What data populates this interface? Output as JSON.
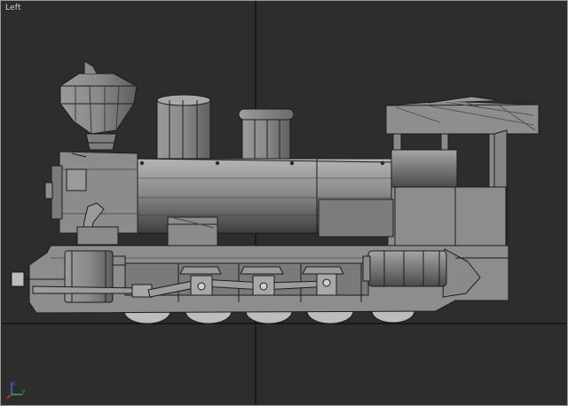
{
  "viewport": {
    "label": "Left",
    "background": "#2d2d2d",
    "grid_color": "#050505",
    "frame_color": "#9a9a9a"
  },
  "model": {
    "subject": "steam-locomotive",
    "render_mode": "smooth-shaded-with-wireframe-edges",
    "fill_color": "#8d8d8d",
    "edge_color": "#1c1c1c"
  },
  "gizmo": {
    "icon": "axis-tripod-icon",
    "colors": {
      "x": "#d23a2a",
      "y": "#38b03a",
      "z": "#2f6fe0"
    }
  }
}
